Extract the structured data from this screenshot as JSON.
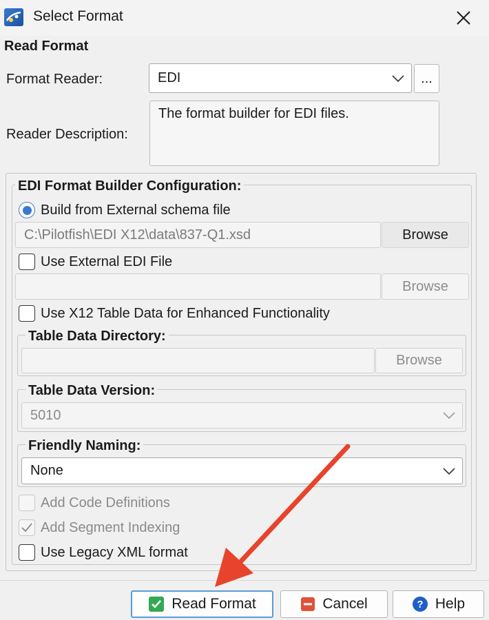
{
  "window": {
    "title": "Select Format"
  },
  "read_format": {
    "section_label": "Read Format",
    "reader_label": "Format Reader:",
    "reader_value": "EDI",
    "more_label": "...",
    "description_label": "Reader Description:",
    "description_text": "The format builder for EDI files."
  },
  "config": {
    "title": "EDI Format Builder Configuration:",
    "schema_radio_label": "Build from External schema file",
    "schema_path": "C:\\Pilotfish\\EDI X12\\data\\837-Q1.xsd",
    "browse_label": "Browse",
    "external_edi_label": "Use External EDI File",
    "external_edi_path": "",
    "x12_table_label": "Use X12 Table Data for Enhanced Functionality",
    "table_dir_title": "Table Data Directory:",
    "table_dir_path": "",
    "table_version_title": "Table Data Version:",
    "table_version_value": "5010",
    "friendly_title": "Friendly Naming:",
    "friendly_value": "None",
    "add_code_label": "Add Code Definitions",
    "add_segment_label": "Add Segment Indexing",
    "legacy_xml_label": "Use Legacy XML format"
  },
  "footer": {
    "read_label": "Read Format",
    "cancel_label": "Cancel",
    "help_label": "Help"
  },
  "colors": {
    "accent": "#3a78d8",
    "annotation_arrow": "#e8432c",
    "ok_green": "#34a853",
    "cancel_red": "#e0503a",
    "help_blue": "#1f5fc6"
  }
}
